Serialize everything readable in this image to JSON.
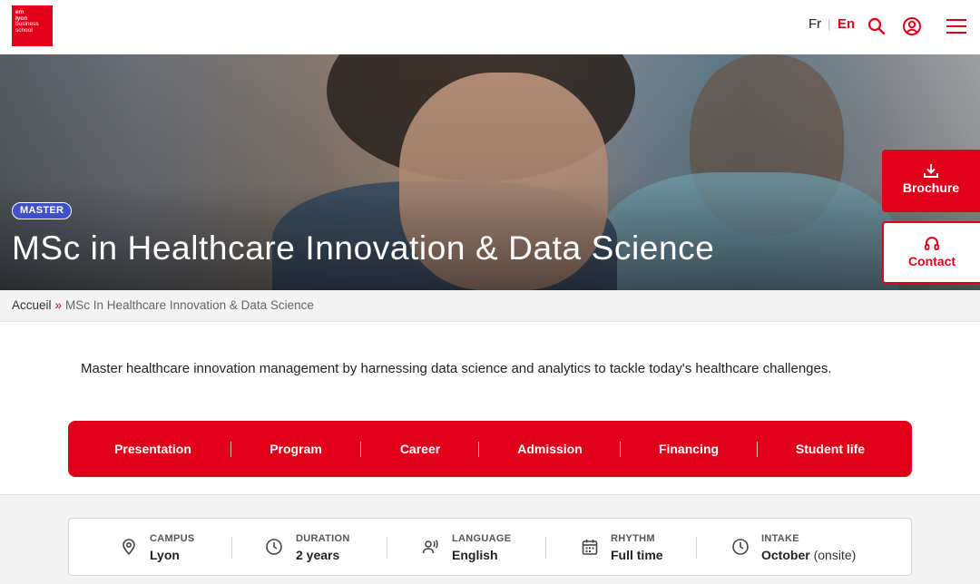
{
  "header": {
    "logo_lines": [
      "em",
      "lyon",
      "business",
      "school"
    ],
    "lang_fr": "Fr",
    "lang_sep": "|",
    "lang_en": "En",
    "icons": [
      "search-icon",
      "user-icon",
      "menu-icon"
    ]
  },
  "hero": {
    "badge": "MASTER",
    "title": "MSc in Healthcare Innovation & Data Science"
  },
  "side_actions": {
    "brochure": "Brochure",
    "contact": "Contact"
  },
  "breadcrumb": {
    "home": "Accueil",
    "separator": "»",
    "current": "MSc In Healthcare Innovation & Data Science"
  },
  "intro": "Master healthcare innovation management by harnessing data science and analytics to tackle today's healthcare challenges.",
  "nav": {
    "items": [
      "Presentation",
      "Program",
      "Career",
      "Admission",
      "Financing",
      "Student life"
    ]
  },
  "facts": [
    {
      "icon": "location-pin-icon",
      "label": "CAMPUS",
      "value": "Lyon",
      "extra": ""
    },
    {
      "icon": "clock-icon",
      "label": "DURATION",
      "value": "2 years",
      "extra": ""
    },
    {
      "icon": "speaking-person-icon",
      "label": "LANGUAGE",
      "value": "English",
      "extra": ""
    },
    {
      "icon": "calendar-icon",
      "label": "RHYTHM",
      "value": "Full time",
      "extra": ""
    },
    {
      "icon": "clock-icon",
      "label": "INTAKE",
      "value": "October",
      "extra": "(onsite)"
    }
  ],
  "colors": {
    "brand_red": "#e0001a",
    "badge_blue": "#3f51c8"
  }
}
